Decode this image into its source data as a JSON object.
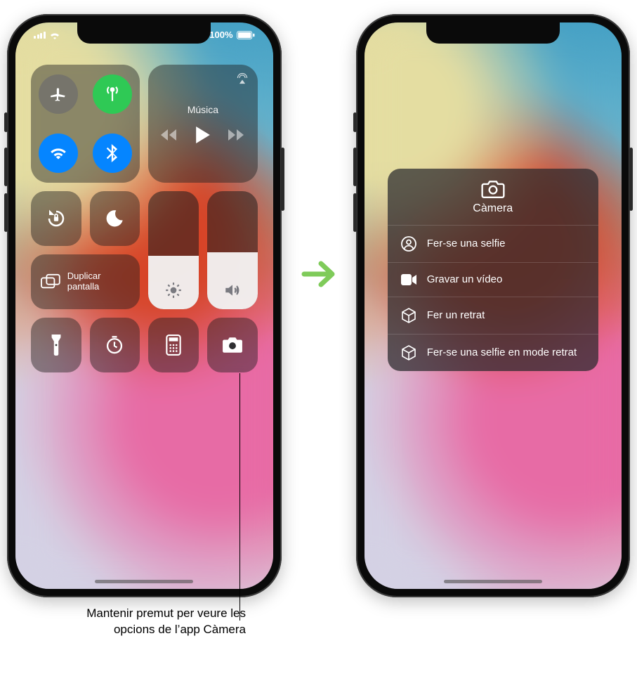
{
  "status": {
    "battery_pct": "100%"
  },
  "cc": {
    "music_label": "Música",
    "mirror_label": "Duplicar pantalla",
    "brightness_level": 0.45,
    "volume_level": 0.48
  },
  "popup": {
    "title": "Càmera",
    "items": [
      {
        "label": "Fer-se una selfie"
      },
      {
        "label": "Gravar un vídeo"
      },
      {
        "label": "Fer un retrat"
      },
      {
        "label": "Fer-se una selfie en mode retrat"
      }
    ]
  },
  "callout": "Mantenir premut per veure les opcions de l’app Càmera"
}
